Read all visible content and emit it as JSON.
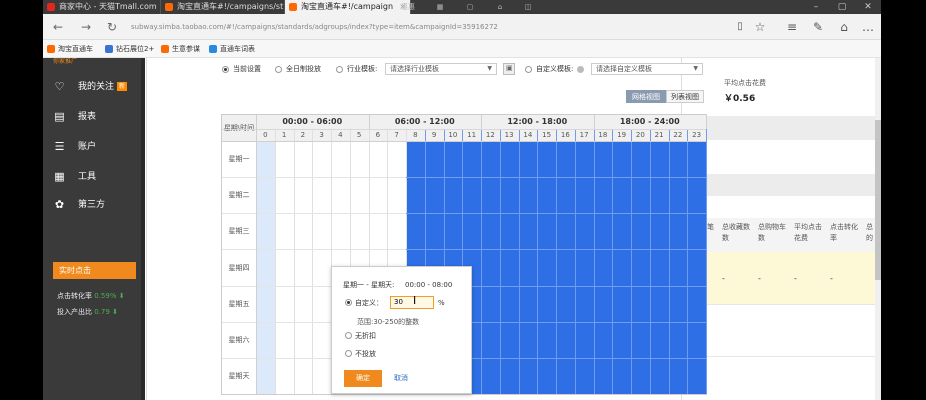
{
  "browser": {
    "tabs": [
      {
        "label": "商家中心 - 天猫Tmall.com",
        "color": "#e0281e"
      },
      {
        "label": "淘宝直通车#!/campaigns/st",
        "color": "#ff6a00"
      },
      {
        "label": "淘宝直通车#!/campaign",
        "color": "#ff6a00"
      },
      {
        "label": "惠惠"
      }
    ],
    "url": "subway.simba.taobao.com/#!/campaigns/standards/adgroups/index?type=item&campaignId=35916272",
    "bookmarks": [
      {
        "label": "淘宝直通车",
        "color": "#ff6a00"
      },
      {
        "label": "钻石展位2+",
        "color": "#3a72d6"
      },
      {
        "label": "生意参谋",
        "color": "#ff6a00"
      },
      {
        "label": "直通车词表",
        "color": "#2a8ae0"
      }
    ],
    "icons": {
      "back": "←",
      "forward": "→",
      "refresh": "↻",
      "lock": "🔒",
      "reader": "▯",
      "favorite": "☆",
      "menu": "≡",
      "notes": "✎",
      "share": "⌂",
      "more": "…"
    }
  },
  "sidebar": {
    "logo_fragment": "你家推广",
    "items": [
      {
        "label": "我的关注",
        "badge": "新",
        "icon": "♡"
      },
      {
        "label": "报表",
        "icon": "▤"
      },
      {
        "label": "账户",
        "icon": "☰"
      },
      {
        "label": "工具",
        "icon": "▦"
      },
      {
        "label": "第三方",
        "icon": "✿"
      }
    ],
    "realtime": {
      "title": "实时点击",
      "rows": [
        {
          "label": "点击转化率",
          "value": "0.59%",
          "arrow": "⬇"
        },
        {
          "label": "投入产出比",
          "value": "0.79",
          "arrow": "⬇"
        }
      ]
    }
  },
  "right_panel": {
    "avg_cost_label": "平均点击花费",
    "avg_cost_value": "￥0.56",
    "columns": [
      {
        "line1": "总成交笔",
        "line2": "数"
      },
      {
        "line1": "总收藏数",
        "line2": "数"
      },
      {
        "line1": "总购物车",
        "line2": "数"
      },
      {
        "line1": "平均点击",
        "line2": "花费"
      },
      {
        "line1": "点击转化",
        "line2": "率"
      },
      {
        "line1": "总",
        "line2": "的"
      }
    ],
    "dash": "-"
  },
  "schedule": {
    "options": {
      "current_setting": "当前设置",
      "all_day": "全日制投放",
      "industry_template": "行业模板:",
      "industry_placeholder": "请选择行业模板",
      "custom_template": "自定义模板:",
      "custom_placeholder": "请选择自定义模板"
    },
    "views": {
      "grid": "网格视图",
      "list": "列表视图"
    },
    "corner_label": "星期\\时间",
    "hour_blocks": [
      "00:00 - 06:00",
      "06:00 - 12:00",
      "12:00 - 18:00",
      "18:00 - 24:00"
    ],
    "hours": [
      "0",
      "1",
      "2",
      "3",
      "4",
      "5",
      "6",
      "7",
      "8",
      "9",
      "10",
      "11",
      "12",
      "13",
      "14",
      "15",
      "16",
      "17",
      "18",
      "19",
      "20",
      "21",
      "22",
      "23"
    ],
    "days": [
      "星期一",
      "星期二",
      "星期三",
      "星期四",
      "星期五",
      "星期六",
      "星期天"
    ],
    "active_from_hour": 8,
    "selected_from_hour": 0,
    "selected_to_hour": 8,
    "colors": {
      "active": "#2f6fe6",
      "selected": "#dce9fb",
      "empty": "#ffffff"
    }
  },
  "popup": {
    "range_label": "星期一 - 星期天:",
    "range_time": "00:00 - 08:00",
    "custom_label": "自定义：",
    "custom_value": "30",
    "percent": "%",
    "range_hint": "范围:30-250的整数",
    "no_discount": "无折扣",
    "no_delivery": "不投放",
    "confirm": "确定",
    "cancel": "取消"
  }
}
